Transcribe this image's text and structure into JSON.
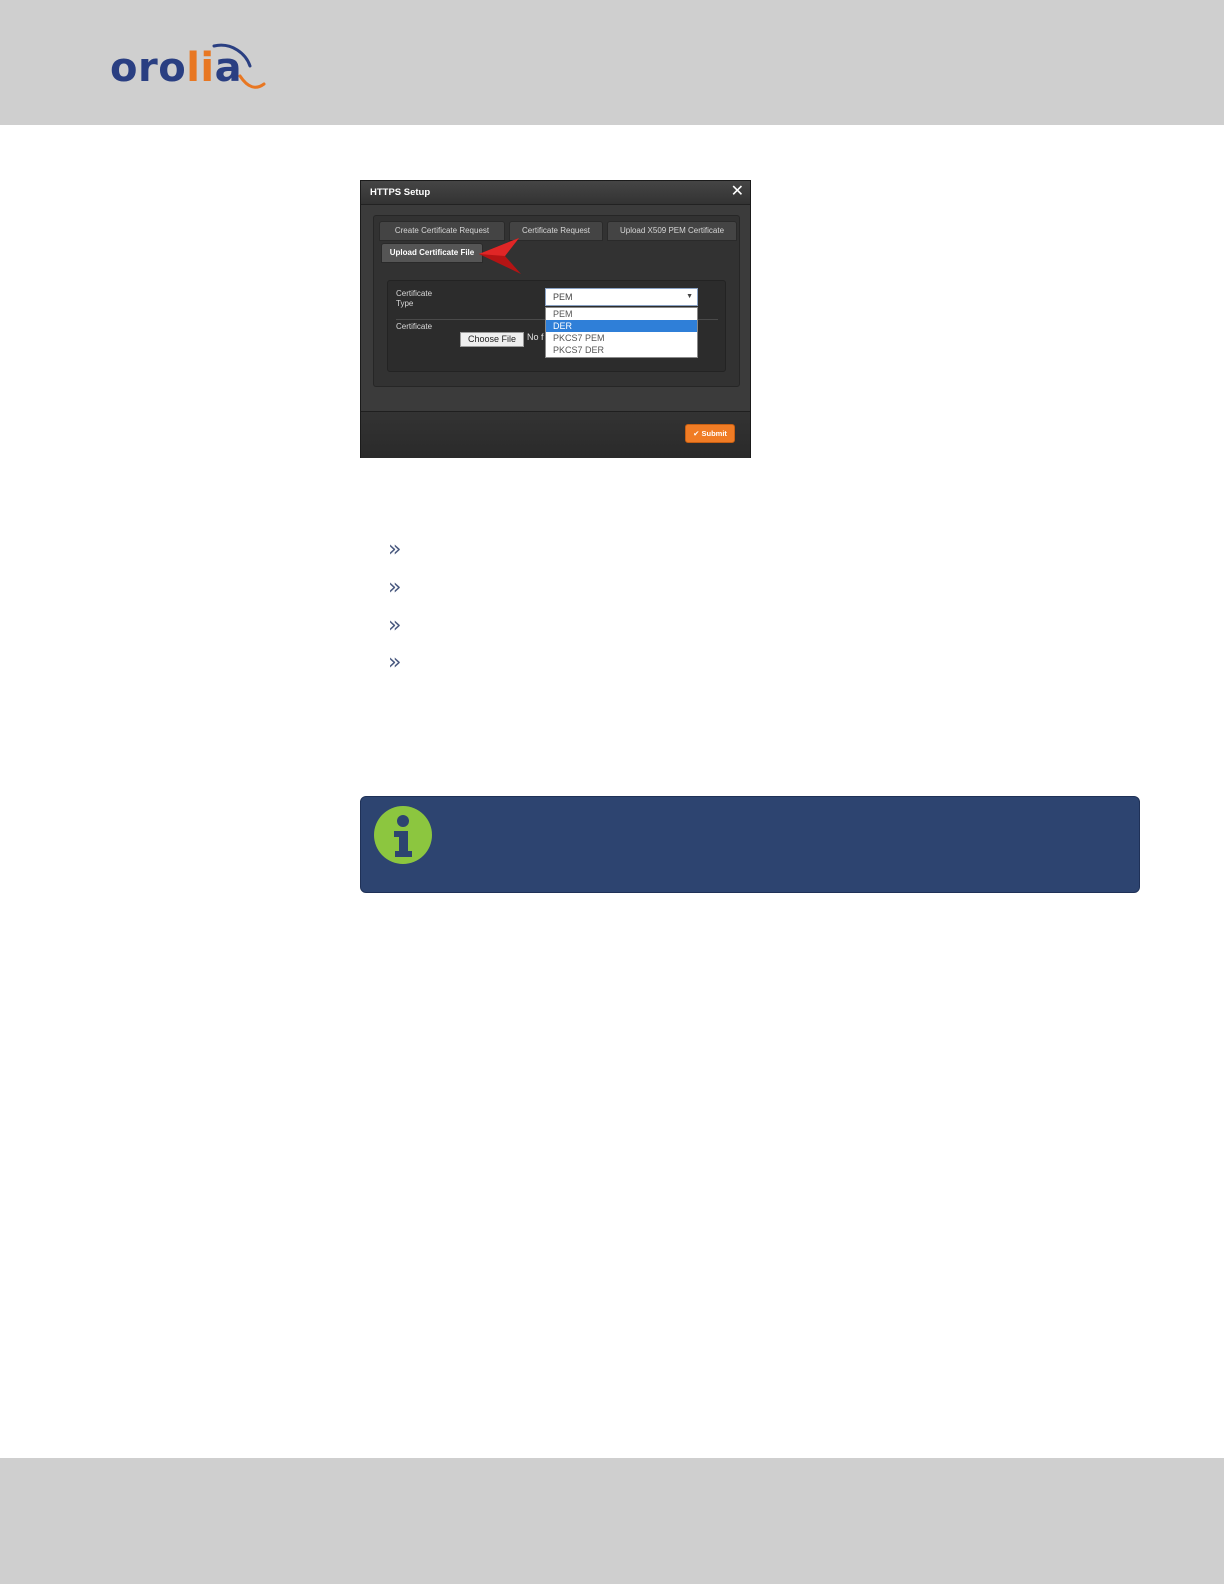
{
  "header": {
    "logo": {
      "text_part1": "oro",
      "text_part2": "li",
      "text_part3": "a",
      "colors": {
        "primary": "#2a3f82",
        "accent": "#e87722"
      }
    }
  },
  "dialog": {
    "title": "HTTPS Setup",
    "close_icon": "close-icon",
    "tabs": [
      {
        "label": "Create Certificate Request",
        "active": false
      },
      {
        "label": "Certificate Request",
        "active": false
      },
      {
        "label": "Upload X509 PEM Certificate",
        "active": false
      },
      {
        "label": "Upload Certificate File",
        "active": true
      }
    ],
    "form": {
      "certificate_type_label": "Certificate\nType",
      "certificate_type_value": "PEM",
      "certificate_type_options": [
        "PEM",
        "DER",
        "PKCS7 PEM",
        "PKCS7 DER"
      ],
      "highlighted_option": "DER",
      "certificate_label": "Certificate",
      "choose_file_label": "Choose File",
      "no_file_text": "No f"
    },
    "submit_label": "Submit",
    "colors": {
      "submit": "#f07c25",
      "highlight": "#2f7fd8"
    }
  },
  "bullets": {
    "icon": "double-chevron-right-icon",
    "count": 4
  },
  "note": {
    "icon": "info-icon",
    "colors": {
      "background": "#2d4470",
      "icon": "#8cc63f"
    }
  }
}
